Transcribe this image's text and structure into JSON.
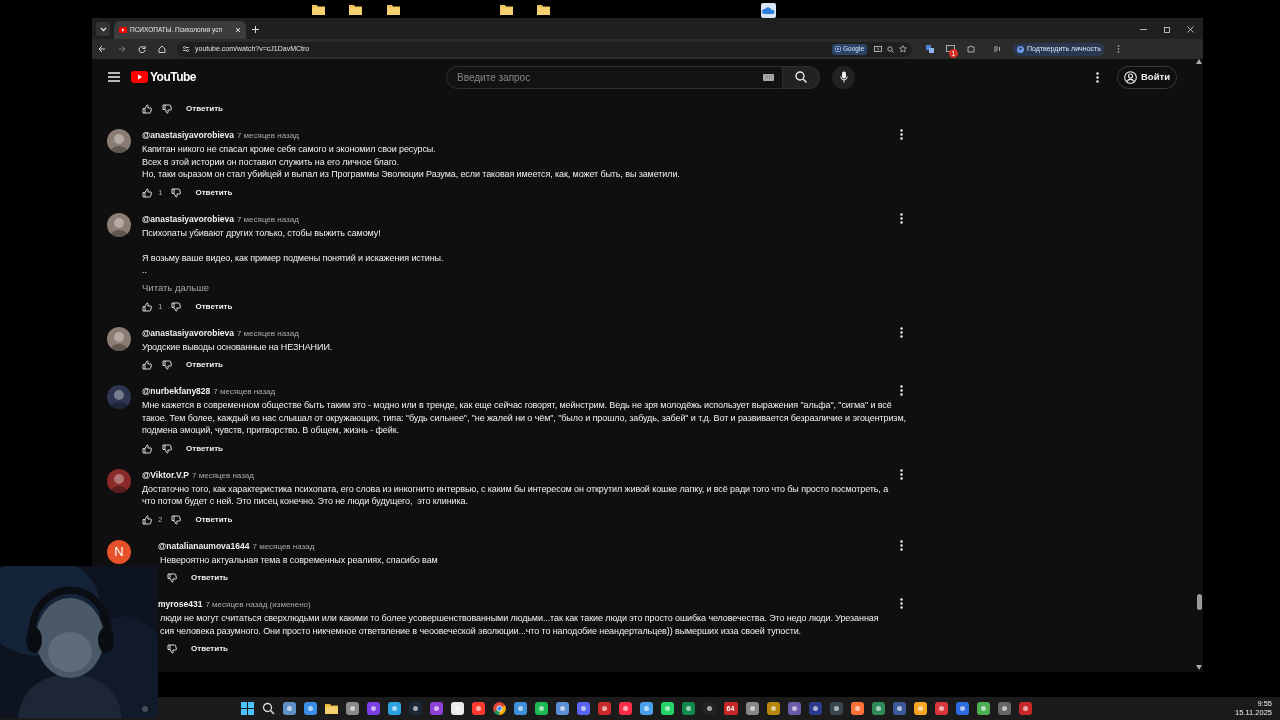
{
  "browser": {
    "tab": {
      "title": "ПСИХОПАТЫ. Психология усп",
      "selected": true
    },
    "address": "youtube.com/watch?v=cJ1DavMCtro",
    "google_chip": "Google",
    "extension_badge": "1",
    "profile_chip": "Подтвердить личность"
  },
  "youtube": {
    "logo": "YouTube",
    "search": {
      "placeholder": "Введите запрос"
    },
    "sign_in": "Войти"
  },
  "top_actions": {
    "reply": "Ответить"
  },
  "comments": [
    {
      "author": "@anastasiyavorobieva",
      "time": "7 месяцев назад",
      "text": "Капитан никого не спасал кроме себя самого и экономил свои ресурсы.\nВсех в этой истории он поставил служить на его личное благо.\nНо, таки оьразом он стал убийцей и выпал из Программы Эволюции Разума, если таковая имеется, как, может быть, вы заметили.",
      "likes": "1",
      "reply": "Ответить",
      "covered": false
    },
    {
      "author": "@anastasiyavorobieva",
      "time": "7 месяцев назад",
      "text": "Психопаты убивают других только, стобы выжить самому!\n\nЯ возьму ваше видео, как пример подмены понятий и искажения истины.\n..",
      "read_more": "Читать дальше",
      "likes": "1",
      "reply": "Ответить",
      "covered": false
    },
    {
      "author": "@anastasiyavorobieva",
      "time": "7 месяцев назад",
      "text": "Уродские выводы основанные на НЕЗНАНИИ.",
      "reply": "Ответить",
      "covered": false
    },
    {
      "author": "@nurbekfany828",
      "time": "7 месяцев назад",
      "text": "Мне кажется в современном обществе быть таким это - модно или в тренде, как еще сейчас говорят, мейнстрим. Ведь не зря молодёжь использует выражения \"альфа\", \"сигма\" и всё\nтакое. Тем более, каждый из нас слышал от окружающих, типа: \"будь сильнее\", \"не жалей ни о чём\", \"было и прошло, забудь, забей\" и т.д. Вот и развивается безразличие и эгоцентризм,\nподмена эмоций, чувств, притворство. В общем, жизнь - фейк.",
      "reply": "Ответить",
      "covered": false
    },
    {
      "author": "@Viktor.V.P",
      "time": "7 месяцев назад",
      "text": "Достаточно того, как характеристика психопата, его слова из инкогнито интервью, с каким бы интересом он открутил живой кошке лапку, и всё ради того что бы просто посмотреть, а\nчто потом будет с ней. Это писец конечно. Это не люди будущего,  это клиника.",
      "likes": "2",
      "reply": "Ответить",
      "covered": false
    },
    {
      "author": "@natalianaumova1644",
      "time": "7 месяцев назад",
      "avatar": {
        "kind": "letter",
        "letter": "N",
        "color": "#e4512a"
      },
      "text": "Невероятно актуальная тема в современных реалиях, спасибо вам",
      "reply": "Ответить",
      "covered": true
    },
    {
      "author": "myrose431",
      "time": "7 месяцев назад (изменено)",
      "text": "люди не могут считаться сверхлюдьми или какими то более усовершенствованными людьми...так как такие люди это просто ошибка человечества. Это недо люди. Урезанная\nсия человека разумного. Они просто никчемное ответвление в чеоовеческой эволюции...что то наподобие неандертальцев)) вымерших изза своей тупости.",
      "reply": "Ответить",
      "covered": true
    }
  ],
  "taskbar": {
    "tile_label": "64",
    "time": "9:55",
    "date": "15.11.2025"
  }
}
